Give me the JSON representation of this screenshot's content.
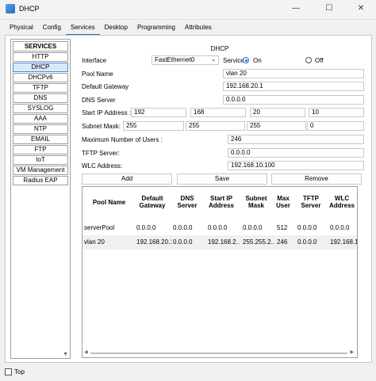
{
  "window": {
    "title": "DHCP",
    "min": "—",
    "max": "☐",
    "close": "✕"
  },
  "tabs": [
    "Physical",
    "Config",
    "Services",
    "Desktop",
    "Programming",
    "Attributes"
  ],
  "active_tab": "Services",
  "sidebar": {
    "header": "SERVICES",
    "items": [
      "HTTP",
      "DHCP",
      "DHCPv6",
      "TFTP",
      "DNS",
      "SYSLOG",
      "AAA",
      "NTP",
      "EMAIL",
      "FTP",
      "IoT",
      "VM Management",
      "Radius EAP"
    ],
    "active": "DHCP"
  },
  "panel": {
    "title": "DHCP",
    "interface_label": "Interface",
    "interface_value": "FastEthernet0",
    "service_label": "Service",
    "on_label": "On",
    "off_label": "Off",
    "service_state": "On",
    "pool_name_label": "Pool Name",
    "pool_name_value": "vlan 20",
    "default_gateway_label": "Default Gateway",
    "default_gateway_value": "192.168.20.1",
    "dns_server_label": "DNS Server",
    "dns_server_value": "0.0.0.0",
    "start_ip_label": "Start IP Address :",
    "start_ip": [
      "192",
      "168",
      "20",
      "10"
    ],
    "subnet_mask_label": "Subnet Mask:",
    "subnet_mask": [
      "255",
      "255",
      "255",
      "0"
    ],
    "max_users_label": "Maximum Number of Users :",
    "max_users_value": "246",
    "tftp_server_label": "TFTP Server:",
    "tftp_server_value": "0.0.0.0",
    "wlc_address_label": "WLC Address:",
    "wlc_address_value": "192.168.10.100",
    "add_label": "Add",
    "save_label": "Save",
    "remove_label": "Remove"
  },
  "table": {
    "headers": [
      "Pool Name",
      "Default Gateway",
      "DNS Server",
      "Start IP Address",
      "Subnet Mask",
      "Max User",
      "TFTP Server",
      "WLC Address"
    ],
    "rows": [
      [
        "serverPool",
        "0.0.0.0",
        "0.0.0.0",
        "0.0.0.0",
        "0.0.0.0",
        "512",
        "0.0.0.0",
        "0.0.0.0"
      ],
      [
        "vlan 20",
        "192.168.20.1",
        "0.0.0.0",
        "192.168.2...",
        "255.255.2...",
        "246",
        "0.0.0.0",
        "192.168.1..."
      ]
    ]
  },
  "footer": {
    "top_label": "Top"
  }
}
